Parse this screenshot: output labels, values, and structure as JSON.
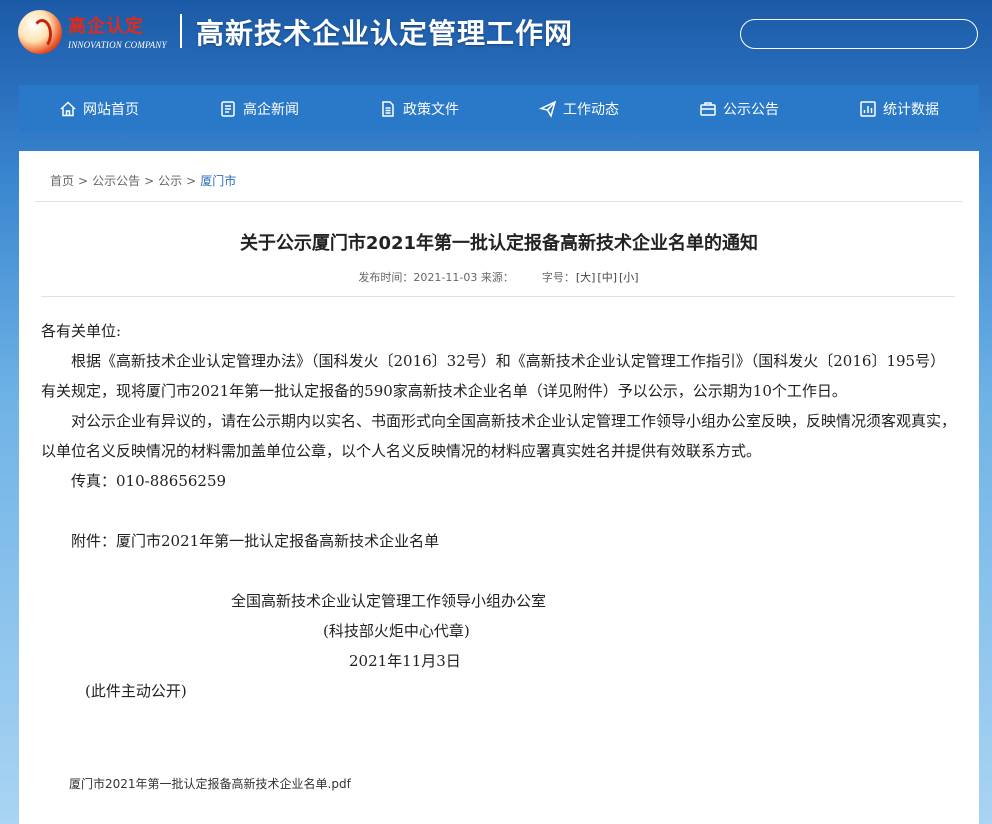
{
  "header": {
    "logo_cn": "高企认定",
    "logo_en": "INNOVATION COMPANY",
    "site_title": "高新技术企业认定管理工作网",
    "search_placeholder": ""
  },
  "nav": {
    "items": [
      {
        "label": "网站首页",
        "icon": "home-icon"
      },
      {
        "label": "高企新闻",
        "icon": "news-icon"
      },
      {
        "label": "政策文件",
        "icon": "document-icon"
      },
      {
        "label": "工作动态",
        "icon": "paper-plane-icon"
      },
      {
        "label": "公示公告",
        "icon": "notice-icon"
      },
      {
        "label": "统计数据",
        "icon": "chart-icon"
      }
    ]
  },
  "breadcrumb": {
    "items": [
      "首页",
      "公示公告",
      "公示",
      "厦门市"
    ],
    "separator": ">"
  },
  "article": {
    "title": "关于公示厦门市2021年第一批认定报备高新技术企业名单的通知",
    "meta_date": "发布时间：2021-11-03 来源：",
    "font_size_label": "字号：",
    "font_sizes": [
      "[大]",
      "[中]",
      "[小]"
    ],
    "greeting": "各有关单位:",
    "paragraphs": [
      "根据《高新技术企业认定管理办法》（国科发火〔2016〕32号）和《高新技术企业认定管理工作指引》（国科发火〔2016〕195号）有关规定，现将厦门市2021年第一批认定报备的590家高新技术企业名单（详见附件）予以公示，公示期为10个工作日。",
      "对公示企业有异议的，请在公示期内以实名、书面形式向全国高新技术企业认定管理工作领导小组办公室反映，反映情况须客观真实，以单位名义反映情况的材料需加盖单位公章，以个人名义反映情况的材料应署真实姓名并提供有效联系方式。",
      "传真：010-88656259"
    ],
    "attachment_line": "附件：厦门市2021年第一批认定报备高新技术企业名单",
    "signature_org": "全国高新技术企业认定管理工作领导小组办公室",
    "signature_sub": "(科技部火炬中心代章)",
    "signature_date": "2021年11月3日",
    "closing": "(此件主动公开)",
    "attachment_file": "厦门市2021年第一批认定报备高新技术企业名单.pdf"
  },
  "colors": {
    "header_bg": "#1b5aa6",
    "nav_bg": "#2a79c8",
    "breadcrumb_current": "#2a6fbd",
    "logo_red": "#e02a1a"
  }
}
